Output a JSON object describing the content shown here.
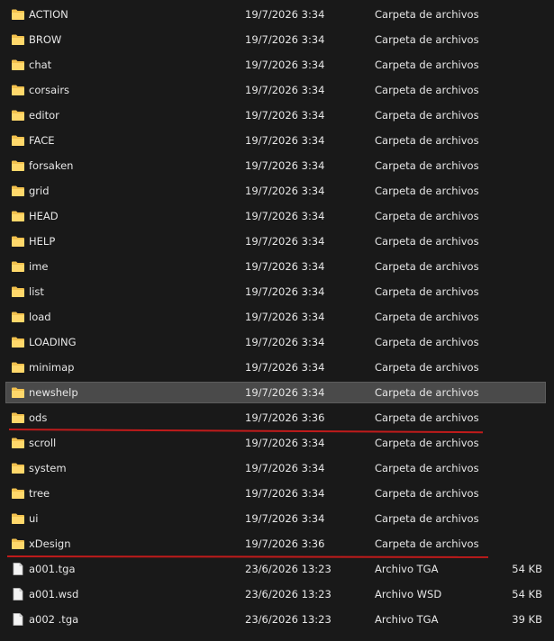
{
  "rows": [
    {
      "name": "ACTION",
      "date": "19/7/2026 3:34",
      "type": "Carpeta de archivos",
      "size": "",
      "kind": "folder"
    },
    {
      "name": "BROW",
      "date": "19/7/2026 3:34",
      "type": "Carpeta de archivos",
      "size": "",
      "kind": "folder"
    },
    {
      "name": "chat",
      "date": "19/7/2026 3:34",
      "type": "Carpeta de archivos",
      "size": "",
      "kind": "folder"
    },
    {
      "name": "corsairs",
      "date": "19/7/2026 3:34",
      "type": "Carpeta de archivos",
      "size": "",
      "kind": "folder"
    },
    {
      "name": "editor",
      "date": "19/7/2026 3:34",
      "type": "Carpeta de archivos",
      "size": "",
      "kind": "folder"
    },
    {
      "name": "FACE",
      "date": "19/7/2026 3:34",
      "type": "Carpeta de archivos",
      "size": "",
      "kind": "folder"
    },
    {
      "name": "forsaken",
      "date": "19/7/2026 3:34",
      "type": "Carpeta de archivos",
      "size": "",
      "kind": "folder"
    },
    {
      "name": "grid",
      "date": "19/7/2026 3:34",
      "type": "Carpeta de archivos",
      "size": "",
      "kind": "folder"
    },
    {
      "name": "HEAD",
      "date": "19/7/2026 3:34",
      "type": "Carpeta de archivos",
      "size": "",
      "kind": "folder"
    },
    {
      "name": "HELP",
      "date": "19/7/2026 3:34",
      "type": "Carpeta de archivos",
      "size": "",
      "kind": "folder"
    },
    {
      "name": "ime",
      "date": "19/7/2026 3:34",
      "type": "Carpeta de archivos",
      "size": "",
      "kind": "folder"
    },
    {
      "name": "list",
      "date": "19/7/2026 3:34",
      "type": "Carpeta de archivos",
      "size": "",
      "kind": "folder"
    },
    {
      "name": "load",
      "date": "19/7/2026 3:34",
      "type": "Carpeta de archivos",
      "size": "",
      "kind": "folder"
    },
    {
      "name": "LOADING",
      "date": "19/7/2026 3:34",
      "type": "Carpeta de archivos",
      "size": "",
      "kind": "folder"
    },
    {
      "name": "minimap",
      "date": "19/7/2026 3:34",
      "type": "Carpeta de archivos",
      "size": "",
      "kind": "folder"
    },
    {
      "name": "newshelp",
      "date": "19/7/2026 3:34",
      "type": "Carpeta de archivos",
      "size": "",
      "kind": "folder",
      "selected": true
    },
    {
      "name": "ods",
      "date": "19/7/2026 3:36",
      "type": "Carpeta de archivos",
      "size": "",
      "kind": "folder"
    },
    {
      "name": "scroll",
      "date": "19/7/2026 3:34",
      "type": "Carpeta de archivos",
      "size": "",
      "kind": "folder"
    },
    {
      "name": "system",
      "date": "19/7/2026 3:34",
      "type": "Carpeta de archivos",
      "size": "",
      "kind": "folder"
    },
    {
      "name": "tree",
      "date": "19/7/2026 3:34",
      "type": "Carpeta de archivos",
      "size": "",
      "kind": "folder"
    },
    {
      "name": "ui",
      "date": "19/7/2026 3:34",
      "type": "Carpeta de archivos",
      "size": "",
      "kind": "folder"
    },
    {
      "name": "xDesign",
      "date": "19/7/2026 3:36",
      "type": "Carpeta de archivos",
      "size": "",
      "kind": "folder"
    },
    {
      "name": "a001.tga",
      "date": "23/6/2026 13:23",
      "type": "Archivo TGA",
      "size": "54 KB",
      "kind": "file"
    },
    {
      "name": "a001.wsd",
      "date": "23/6/2026 13:23",
      "type": "Archivo WSD",
      "size": "54 KB",
      "kind": "file"
    },
    {
      "name": "a002 .tga",
      "date": "23/6/2026 13:23",
      "type": "Archivo TGA",
      "size": "39 KB",
      "kind": "file"
    }
  ],
  "annotation_color": "#c11b1b",
  "folder_color": "#f2c14e"
}
